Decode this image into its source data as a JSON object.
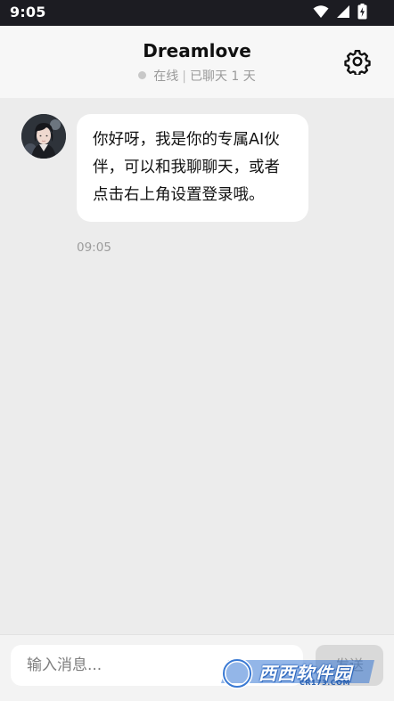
{
  "status_bar": {
    "time": "9:05",
    "icons": [
      "wifi-icon",
      "cellular-signal-icon",
      "battery-charging-icon"
    ]
  },
  "header": {
    "title": "Dreamlove",
    "status": "在线",
    "separator": "|",
    "days_chatted": "已聊天 1 天",
    "settings_icon": "gear-icon"
  },
  "messages": [
    {
      "from": "ai",
      "text": "你好呀，我是你的专属AI伙伴，可以和我聊聊天，或者点击右上角设置登录哦。",
      "time": "09:05"
    }
  ],
  "input_bar": {
    "placeholder": "输入消息...",
    "send_label": "发送"
  },
  "watermark": {
    "brand": "西西软件园",
    "url": "CR173.COM"
  },
  "colors": {
    "status_bar_bg": "#1c1c22",
    "header_bg": "#f7f7f7",
    "chat_bg": "#ececec",
    "bubble_bg": "#ffffff",
    "send_bg": "#d9d9d9"
  }
}
